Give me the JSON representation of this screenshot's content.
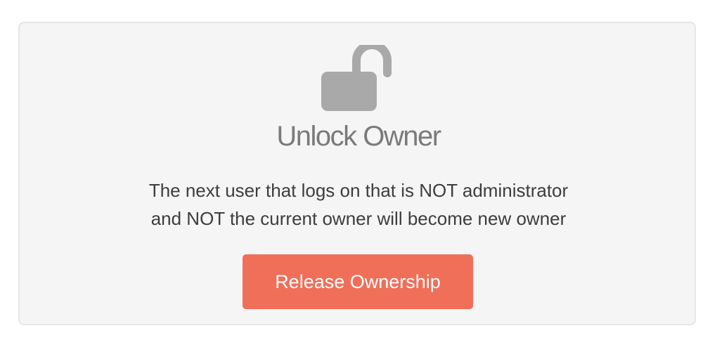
{
  "card": {
    "icon": "unlocked-padlock-icon",
    "title": "Unlock Owner",
    "description_line1": "The next user that logs on that is NOT administrator",
    "description_line2": "and NOT the current owner will become new owner",
    "button_label": "Release Ownership"
  },
  "colors": {
    "panel_background": "#f5f5f5",
    "panel_border": "#e6e6e6",
    "icon": "#a9a9a9",
    "title": "#7a7a7a",
    "text": "#3d3d3d",
    "button": "#ef6f58",
    "button_text": "#ffffff"
  }
}
